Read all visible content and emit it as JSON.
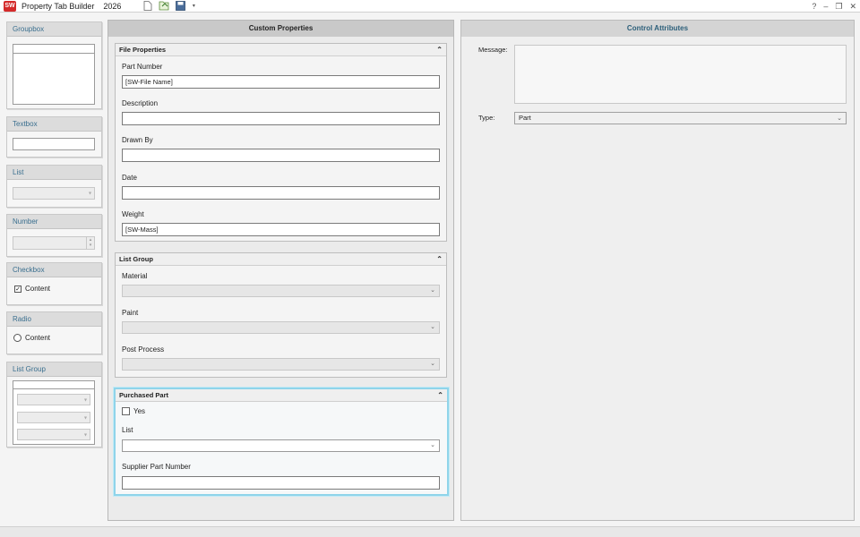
{
  "app": {
    "logo": "SW",
    "title": "Property Tab Builder",
    "year": "2026"
  },
  "toolbar": {
    "icons": [
      "new-file-icon",
      "open-file-icon",
      "save-icon"
    ]
  },
  "window_controls": {
    "help": "?",
    "minimize": "–",
    "restore": "❐",
    "close": "✕"
  },
  "toolbox": {
    "groupbox": "Groupbox",
    "textbox": "Textbox",
    "list": "List",
    "number": "Number",
    "checkbox": "Checkbox",
    "checkbox_content": "Content",
    "radio": "Radio",
    "radio_content": "Content",
    "list_group": "List Group"
  },
  "center": {
    "title": "Custom Properties",
    "file_properties": {
      "title": "File Properties",
      "part_number_label": "Part Number",
      "part_number_value": "[SW-File Name]",
      "description_label": "Description",
      "description_value": "",
      "drawn_by_label": "Drawn By",
      "drawn_by_value": "",
      "date_label": "Date",
      "date_value": "",
      "weight_label": "Weight",
      "weight_value": "[SW-Mass]"
    },
    "list_group": {
      "title": "List Group",
      "material_label": "Material",
      "paint_label": "Paint",
      "post_process_label": "Post Process"
    },
    "purchased_part": {
      "title": "Purchased Part",
      "yes_label": "Yes",
      "list_label": "List",
      "supplier_label": "Supplier Part Number",
      "supplier_value": ""
    }
  },
  "right": {
    "title": "Control Attributes",
    "message_label": "Message:",
    "message_value": "",
    "type_label": "Type:",
    "type_value": "Part"
  }
}
